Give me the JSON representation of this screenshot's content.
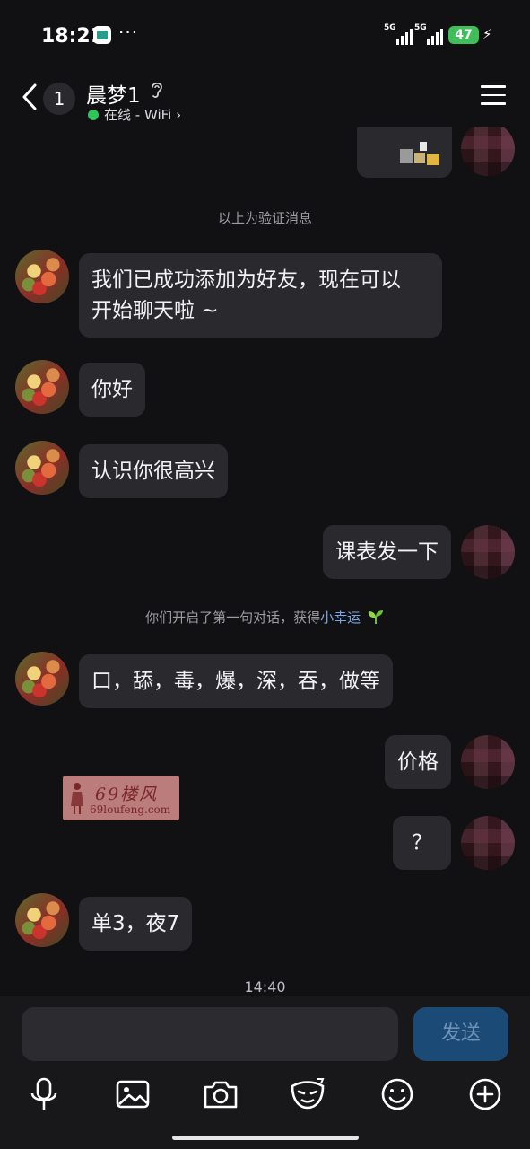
{
  "status_bar": {
    "time": "18:21",
    "dots": "···",
    "signal1_label": "5G",
    "signal2_label": "5G",
    "battery": "47",
    "battery_color": "#3fbe5a"
  },
  "header": {
    "unread_count": "1",
    "contact_name": "晨梦1",
    "status_text": "在线 - WiFi ›",
    "online_color": "#31c45c"
  },
  "chat": {
    "system_verify": "以上为验证消息",
    "messages": [
      {
        "side": "left",
        "text_line1": "我们已成功添加为好友，现在可以",
        "text_line2": "开始聊天啦 ~"
      },
      {
        "side": "left",
        "text": "你好"
      },
      {
        "side": "left",
        "text": "认识你很高兴"
      },
      {
        "side": "right",
        "text": "课表发一下"
      },
      {
        "side": "left",
        "text": "口，舔，毒，爆，深，吞，做等"
      },
      {
        "side": "right",
        "text": "价格"
      },
      {
        "side": "right",
        "text": "？"
      },
      {
        "side": "left",
        "text": "单3，夜7"
      }
    ],
    "first_talk_note": "你们开启了第一句对话，获得",
    "first_talk_link": "小幸运",
    "time_stamp": "14:40"
  },
  "watermark": {
    "title": "69楼风",
    "url": "69loufeng.com"
  },
  "composer": {
    "input_value": "",
    "send_label": "发送",
    "tools": [
      "microphone-icon",
      "image-icon",
      "camera-icon",
      "fun-mask-icon",
      "emoji-icon",
      "plus-icon"
    ]
  },
  "colors": {
    "background": "#111113",
    "bubble": "#2a2a2e",
    "link": "#7ea6e6",
    "send_button": "#1c4a76"
  }
}
